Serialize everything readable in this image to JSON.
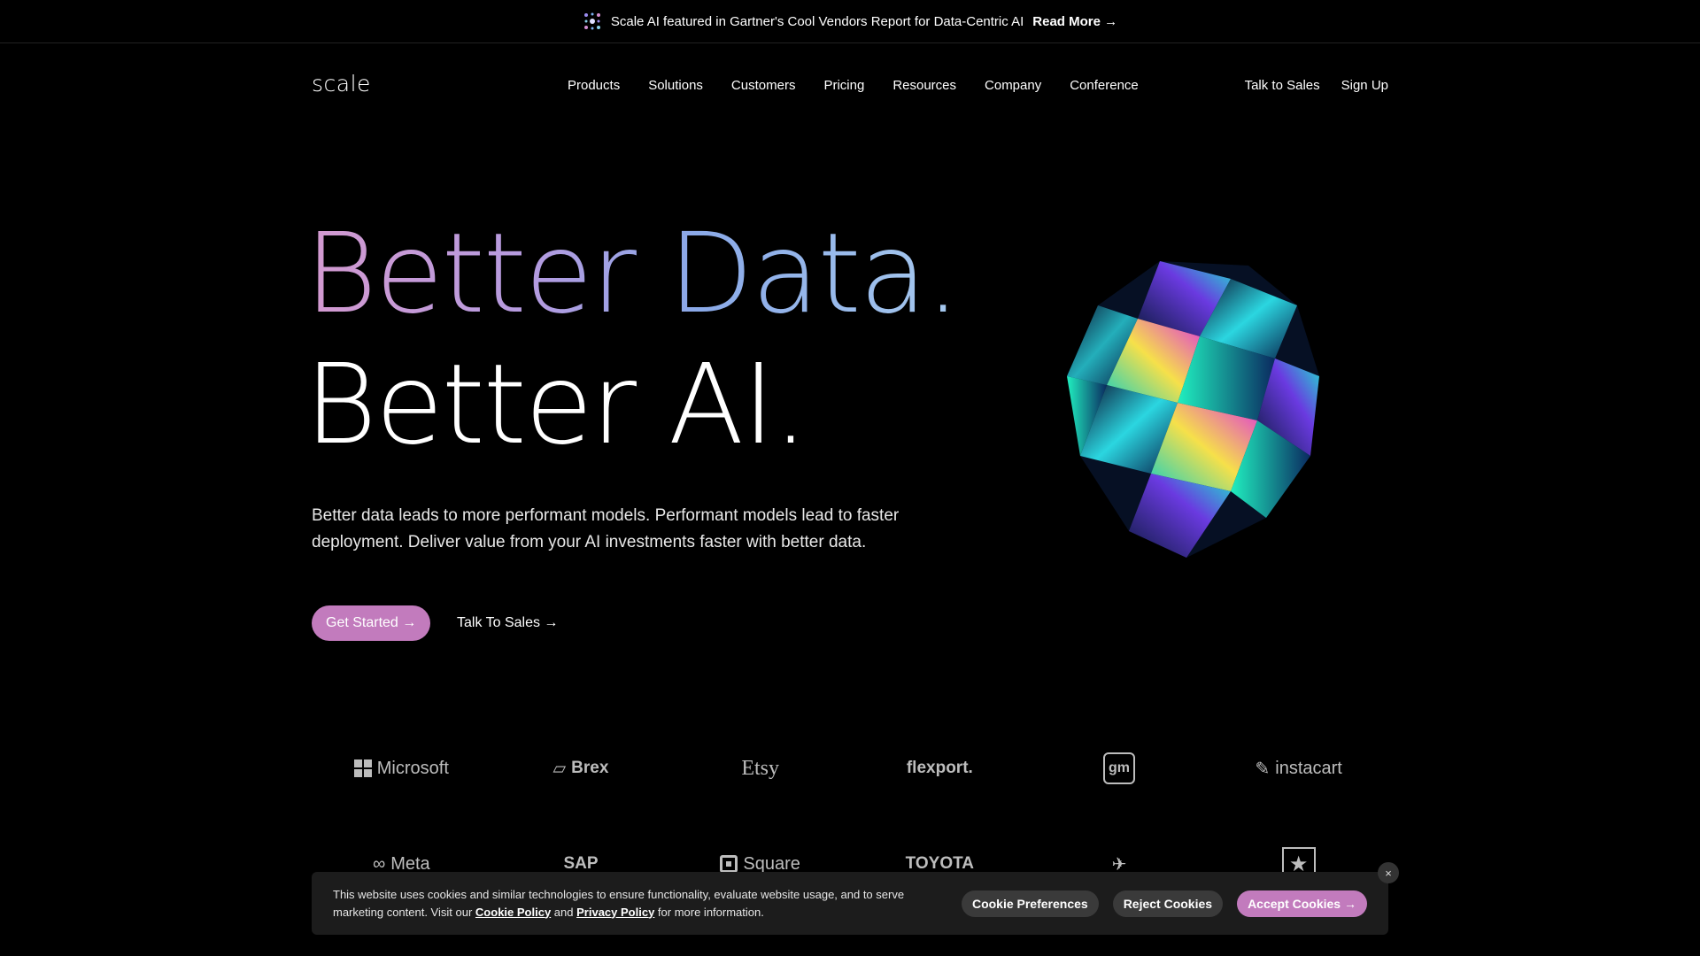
{
  "announcement": {
    "text": "Scale AI featured in Gartner's Cool Vendors Report for Data-Centric AI",
    "link": "Read More →"
  },
  "header": {
    "logo": "scale",
    "nav": [
      "Products",
      "Solutions",
      "Customers",
      "Pricing",
      "Resources",
      "Company",
      "Conference"
    ],
    "talk_to_sales": "Talk to Sales",
    "sign_up": "Sign Up"
  },
  "hero": {
    "headline_1": "Better Data.",
    "headline_2": "Better AI.",
    "lead": "Better data leads to more performant models. Performant models lead to faster deployment. Deliver value from your AI investments faster with better data.",
    "cta_primary": "Get Started →",
    "cta_secondary": "Talk To Sales →"
  },
  "logos": {
    "row1": [
      "Microsoft",
      "Brex",
      "Etsy",
      "flexport.",
      "gm",
      "instacart"
    ],
    "row2": [
      "Meta",
      "SAP",
      "Square",
      "TOYOTA",
      "air-force-icon",
      "army-icon"
    ]
  },
  "cookie": {
    "text_1": "This website uses cookies and similar technologies to ensure functionality, evaluate website usage, and to serve marketing content. Visit our",
    "cookie_policy": "Cookie Policy",
    "and": "and",
    "privacy_policy": "Privacy Policy",
    "text_2": "for more information.",
    "preferences": "Cookie Preferences",
    "reject": "Reject Cookies",
    "accept": "Accept Cookies →",
    "close": "×"
  },
  "colors": {
    "accent": "#c27bbd",
    "background": "#000000"
  }
}
